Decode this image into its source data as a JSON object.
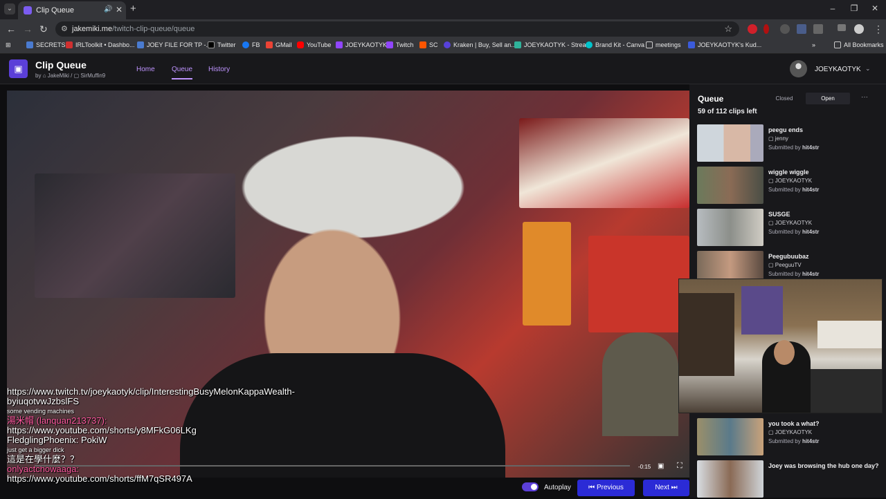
{
  "browser": {
    "tab_title": "Clip Queue",
    "url_host": "jakemiki.me",
    "url_path": "/twitch-clip-queue/queue",
    "bookmarks": [
      "SECRETS",
      "IRLToolkit • Dashbo...",
      "JOEY FILE FOR TP -...",
      "Twitter",
      "FB",
      "GMail",
      "YouTube",
      "JOEYKAOTYK",
      "Twitch",
      "SC",
      "Kraken | Buy, Sell an...",
      "JOEYKAOTYK - Strea...",
      "Brand Kit - Canva",
      "meetings",
      "JOEYKAOTYK's Kud..."
    ],
    "all_bookmarks": "All Bookmarks"
  },
  "app": {
    "title": "Clip Queue",
    "by_prefix": "by",
    "author1": "JakeMiki",
    "author2": "SirMuffin9",
    "nav": [
      "Home",
      "Queue",
      "History"
    ],
    "user": "JOEYKAOTYK"
  },
  "video": {
    "time_left": "-0:15",
    "chat": [
      "https://www.twitch.tv/joeykaotyk/clip/InterestingBusyMelonKappaWealth-byiuqotvwJzbslFS",
      "some vending machines",
      "湯米帽 (lanquan213737):",
      "https://www.youtube.com/shorts/y8MFkG06LKg",
      "FledglingPhoenix: PokiW",
      "just get a bigger dick",
      "這是在學什麼？？",
      "onlyactchowaaga:",
      "https://www.youtube.com/shorts/ffM7qSR497A"
    ]
  },
  "controls": {
    "autoplay": "Autoplay",
    "previous": "Previous",
    "next": "Next"
  },
  "queue": {
    "title": "Queue",
    "closed": "Closed",
    "open": "Open",
    "more": "···",
    "clips_left": "59 of 112 clips left",
    "submitted_by": "Submitted by",
    "clips": [
      {
        "title": "peegu ends",
        "channel": "jenny",
        "submitter": "hit4str"
      },
      {
        "title": "wiggle wiggle",
        "channel": "JOEYKAOTYK",
        "submitter": "hit4str"
      },
      {
        "title": "SUSGE",
        "channel": "JOEYKAOTYK",
        "submitter": "hit4str"
      },
      {
        "title": "Peegubuubaz",
        "channel": "PeeguuTV",
        "submitter": "hit4str"
      },
      {
        "title": "you took a what?",
        "channel": "JOEYKAOTYK",
        "submitter": "hit4str"
      },
      {
        "title": "Joey was browsing the hub one day?",
        "channel": "",
        "submitter": ""
      }
    ]
  },
  "colors": {
    "accent": "#bf94ff",
    "button": "#2b2bd6",
    "logo": "#5b3fd8"
  }
}
